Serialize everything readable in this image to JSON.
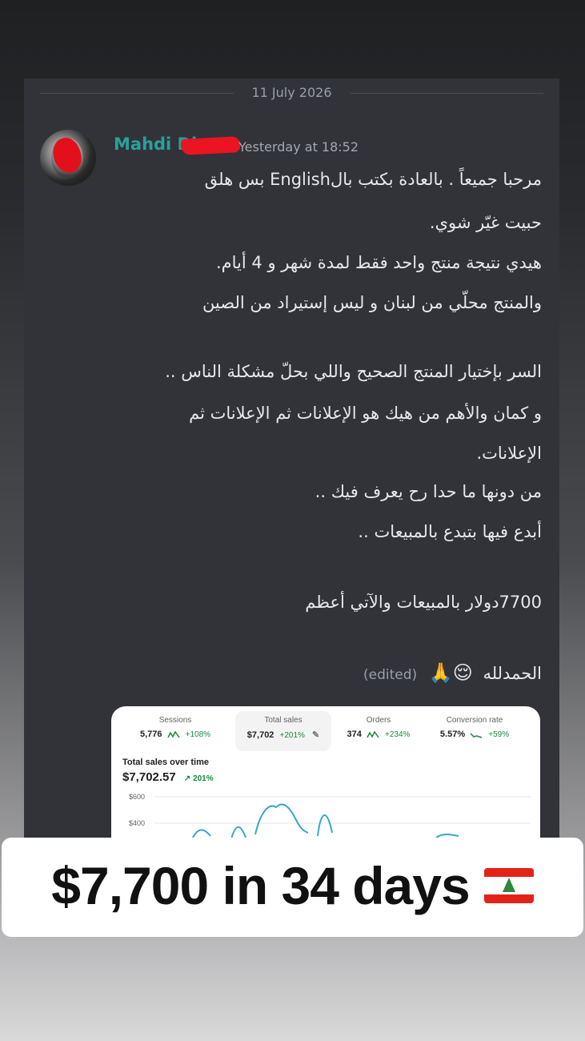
{
  "chat": {
    "date_divider": "11 July 2026",
    "username": "Mahdi Di",
    "timestamp": "Yesterday at 18:52",
    "message_lines": [
      "مرحبا جميعاً . بالعادة بكتب بالEnglish بس هلق",
      "حبيت غيّر شوي.",
      "هيدي نتيجة منتج واحد فقط لمدة شهر و 4 أيام.",
      "والمنتج محلّي من لبنان و ليس إستيراد من الصين",
      "السر بإختيار المنتج الصحيح واللي بحلّ مشكلة الناس ..",
      "و كمان والأهم من هيك هو الإعلانات ثم الإعلانات ثم",
      "الإعلانات.",
      "من دونها ما حدا رح يعرف فيك ..",
      "أبدع فيها بتبدع بالمبيعات ..",
      "7700دولار بالمبيعات والآتي أعظم",
      "الحمدلله"
    ],
    "emojis": "😌🙏",
    "edited_label": "(edited)"
  },
  "analytics": {
    "metrics": [
      {
        "label": "Sessions",
        "value": "5,776",
        "change": "+108%"
      },
      {
        "label": "Total sales",
        "value": "$7,702",
        "change": "+201%"
      },
      {
        "label": "Orders",
        "value": "374",
        "change": "+234%"
      },
      {
        "label": "Conversion rate",
        "value": "5.57%",
        "change": "+59%"
      }
    ],
    "chart_title": "Total sales over time",
    "chart_total": "$7,702.57",
    "chart_change": "↗ 201%",
    "y_ticks": [
      "$600",
      "$400"
    ]
  },
  "banner": {
    "text": "$7,700 in 34 days",
    "flag_icon": "lebanon-flag-icon"
  },
  "colors": {
    "username": "#2aa19b",
    "panel_bg": "#313338",
    "positive": "#1a8a3a"
  }
}
